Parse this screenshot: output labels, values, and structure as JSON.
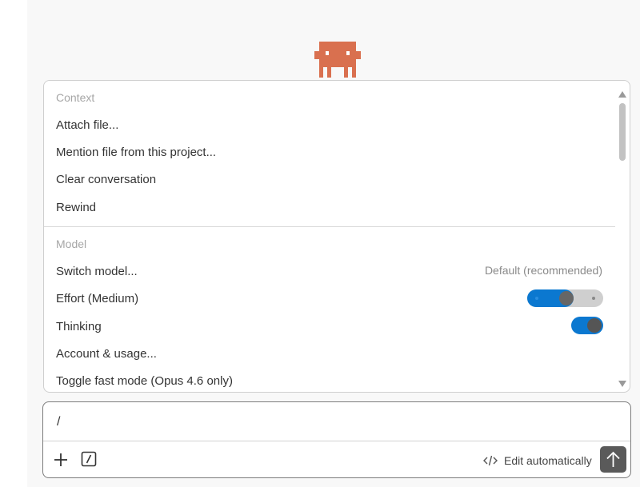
{
  "mascot": {
    "icon": "pixel-creature-icon",
    "color": "#d9704f"
  },
  "menu": {
    "sections": [
      {
        "title": "Context",
        "items": [
          {
            "label": "Attach file..."
          },
          {
            "label": "Mention file from this project..."
          },
          {
            "label": "Clear conversation"
          },
          {
            "label": "Rewind"
          }
        ]
      },
      {
        "title": "Model",
        "items": [
          {
            "label": "Switch model...",
            "value": "Default (recommended)"
          },
          {
            "label": "Effort (Medium)",
            "control": "slider-toggle",
            "level": "medium"
          },
          {
            "label": "Thinking",
            "control": "toggle",
            "on": true
          },
          {
            "label": "Account & usage..."
          },
          {
            "label": "Toggle fast mode (Opus 4.6 only)"
          }
        ]
      }
    ]
  },
  "input": {
    "value": "/",
    "add_icon": "plus-icon",
    "slash_icon": "slash-command-icon",
    "edit_mode": {
      "icon": "code-icon",
      "label": "Edit automatically"
    },
    "send_icon": "arrow-up-icon"
  },
  "colors": {
    "accent": "#0b78d0",
    "mascot": "#d9704f",
    "send_button": "#5a5a5a"
  }
}
